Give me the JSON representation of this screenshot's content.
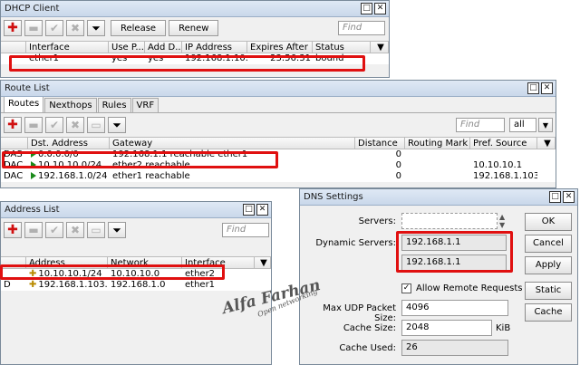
{
  "dhcp": {
    "title": "DHCP Client",
    "release_label": "Release",
    "renew_label": "Renew",
    "find_placeholder": "Find",
    "columns": [
      "Interface",
      "Use P...",
      "Add D...",
      "IP Address",
      "Expires After",
      "Status"
    ],
    "row": {
      "interface": "ether1",
      "use_peer": "yes",
      "add_default": "yes",
      "ip": "192.168.1.10...",
      "expires": "23:56:31",
      "status": "bound"
    }
  },
  "routes": {
    "title": "Route List",
    "tabs": [
      "Routes",
      "Nexthops",
      "Rules",
      "VRF"
    ],
    "find_placeholder": "Find",
    "filter_value": "all",
    "columns": [
      "Dst. Address",
      "Gateway",
      "Distance",
      "Routing Mark",
      "Pref. Source"
    ],
    "rows": [
      {
        "flags": "DAS",
        "dst": "0.0.0.0/0",
        "gateway": "192.168.1.1 reachable ether1",
        "distance": "0",
        "mark": "",
        "pref": ""
      },
      {
        "flags": "DAC",
        "dst": "10.10.10.0/24",
        "gateway": "ether2 reachable",
        "distance": "0",
        "mark": "",
        "pref": "10.10.10.1"
      },
      {
        "flags": "DAC",
        "dst": "192.168.1.0/24",
        "gateway": "ether1 reachable",
        "distance": "0",
        "mark": "",
        "pref": "192.168.1.103"
      }
    ]
  },
  "addresses": {
    "title": "Address List",
    "find_placeholder": "Find",
    "columns": [
      "Address",
      "Network",
      "Interface"
    ],
    "rows": [
      {
        "flag": "",
        "address": "10.10.10.1/24",
        "network": "10.10.10.0",
        "interface": "ether2"
      },
      {
        "flag": "D",
        "address": "192.168.1.103...",
        "network": "192.168.1.0",
        "interface": "ether1"
      }
    ]
  },
  "dns": {
    "title": "DNS Settings",
    "servers_label": "Servers:",
    "servers_value": "",
    "dynamic_label": "Dynamic Servers:",
    "dynamic_servers": [
      "192.168.1.1",
      "192.168.1.1"
    ],
    "allow_remote_label": "Allow Remote Requests",
    "max_udp_label": "Max UDP Packet Size:",
    "max_udp_value": "4096",
    "cache_size_label": "Cache Size:",
    "cache_size_value": "2048",
    "cache_size_unit": "KiB",
    "cache_used_label": "Cache Used:",
    "cache_used_value": "26",
    "ok_label": "OK",
    "cancel_label": "Cancel",
    "apply_label": "Apply",
    "static_label": "Static",
    "cache_label": "Cache"
  },
  "watermark": {
    "name": "Alfa Farhan",
    "tagline": "Open networking"
  },
  "colors": {
    "highlight": "#e01010",
    "flag_green": "#1a8a1a"
  }
}
